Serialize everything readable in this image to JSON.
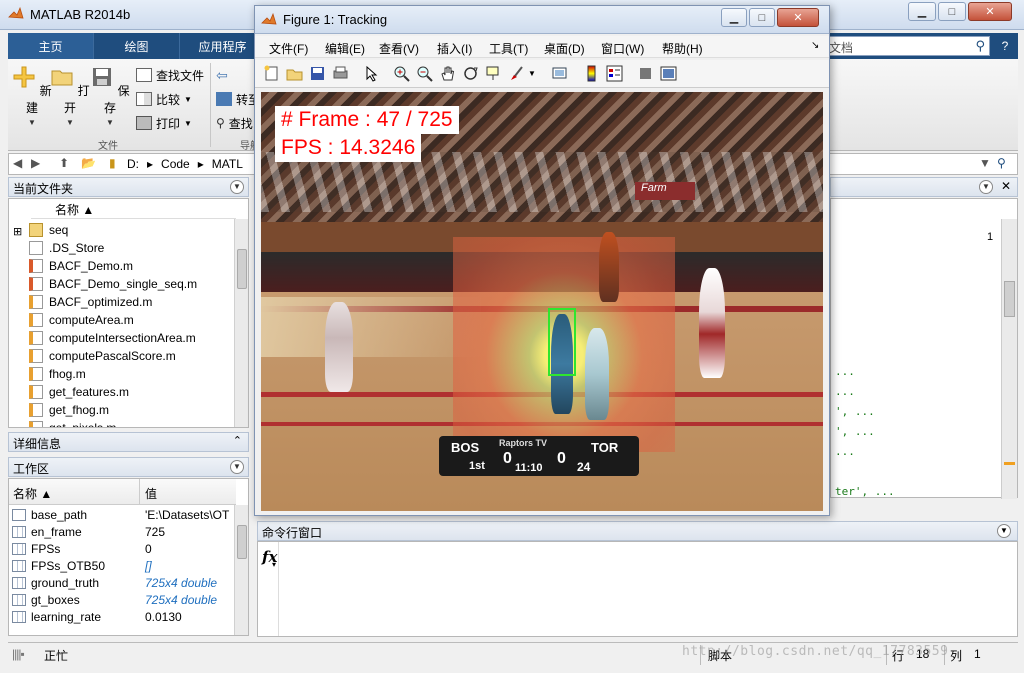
{
  "main_window": {
    "title": "MATLAB R2014b",
    "ribbon_tabs": [
      "主页",
      "绘图",
      "应用程序"
    ],
    "search_placeholder": "文档",
    "help": "?",
    "file_group": {
      "new": "新建",
      "open": "打开",
      "save": "保存",
      "find_files": "查找文件",
      "compare": "比较",
      "print": "打印",
      "group_label": "文件"
    },
    "nav_group": {
      "goto": "转至",
      "find": "查找",
      "group_label": "导航"
    },
    "address": {
      "crumbs": [
        "D:",
        "▸",
        "Code",
        "▸",
        "MATL"
      ]
    }
  },
  "current_folder": {
    "title": "当前文件夹",
    "column_header": "名称 ▲",
    "items": [
      {
        "name": "seq",
        "type": "folder"
      },
      {
        "name": ".DS_Store",
        "type": "file"
      },
      {
        "name": "BACF_Demo.m",
        "type": "script"
      },
      {
        "name": "BACF_Demo_single_seq.m",
        "type": "script"
      },
      {
        "name": "BACF_optimized.m",
        "type": "function"
      },
      {
        "name": "computeArea.m",
        "type": "function"
      },
      {
        "name": "computeIntersectionArea.m",
        "type": "function"
      },
      {
        "name": "computePascalScore.m",
        "type": "function"
      },
      {
        "name": "fhog.m",
        "type": "function"
      },
      {
        "name": "get_features.m",
        "type": "function"
      },
      {
        "name": "get_fhog.m",
        "type": "function"
      },
      {
        "name": "get_pixels.m",
        "type": "function"
      }
    ]
  },
  "details_panel": {
    "title": "详细信息"
  },
  "workspace": {
    "title": "工作区",
    "col_name": "名称 ▲",
    "col_value": "值",
    "rows": [
      {
        "name": "base_path",
        "value": "'E:\\Datasets\\OT",
        "italic": false
      },
      {
        "name": "en_frame",
        "value": "725",
        "italic": false
      },
      {
        "name": "FPSs",
        "value": "0",
        "italic": false
      },
      {
        "name": "FPSs_OTB50",
        "value": "[]",
        "italic": true
      },
      {
        "name": "ground_truth",
        "value": "725x4 double",
        "italic": true
      },
      {
        "name": "gt_boxes",
        "value": "725x4 double",
        "italic": true
      },
      {
        "name": "learning_rate",
        "value": "0.0130",
        "italic": false
      }
    ]
  },
  "editor": {
    "line_number": "1",
    "lines": [
      "...",
      "...",
      "', ...",
      "', ...",
      "...",
      "ter', ..."
    ]
  },
  "command_window": {
    "title": "命令行窗口",
    "prompt_icon": "fx"
  },
  "status_bar": {
    "state": "正忙",
    "script_label": "脚本",
    "row_label": "行",
    "row_value": "18",
    "col_label": "列",
    "col_value": "1"
  },
  "watermark": "http://blog.csdn.net/qq_17783559",
  "figure": {
    "title": "Figure 1: Tracking",
    "menus": [
      "文件(F)",
      "编辑(E)",
      "查看(V)",
      "插入(I)",
      "工具(T)",
      "桌面(D)",
      "窗口(W)",
      "帮助(H)"
    ],
    "frame_text": "# Frame : 47 / 725",
    "fps_text": "FPS : 14.3246",
    "scoreboard": {
      "team1": "BOS",
      "score1": "0",
      "score2": "0",
      "team2": "TOR",
      "quarter": "1st",
      "clock": "11:10",
      "shot_clock": "24",
      "network": "Raptors TV"
    },
    "sign_text": "Farm",
    "tracker_box_color": "#2ee62e",
    "label_color": "#ff0000"
  }
}
